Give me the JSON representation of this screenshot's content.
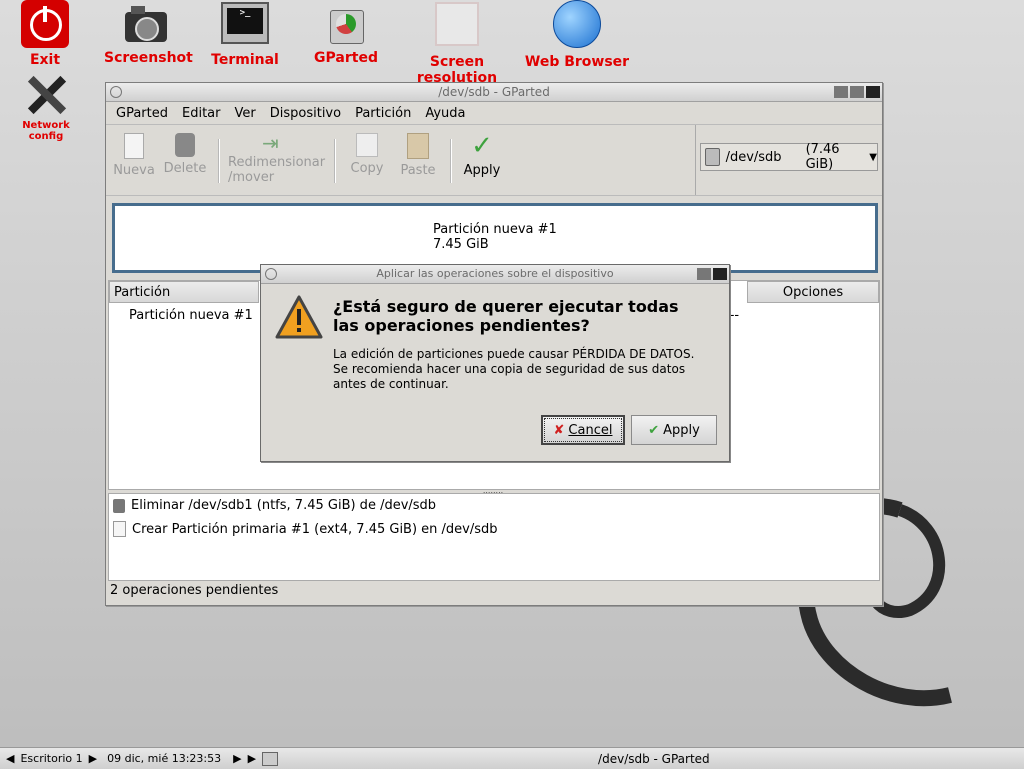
{
  "desktop": {
    "icons": [
      {
        "label": "Exit"
      },
      {
        "label": "Screenshot"
      },
      {
        "label": "Terminal"
      },
      {
        "label": "GParted"
      },
      {
        "label": "Screen resolution"
      },
      {
        "label": "Web Browser"
      },
      {
        "label": "Network config"
      }
    ]
  },
  "window": {
    "title": "/dev/sdb - GParted",
    "menu": [
      "GParted",
      "Editar",
      "Ver",
      "Dispositivo",
      "Partición",
      "Ayuda"
    ],
    "toolbar": {
      "nueva": "Nueva",
      "delete": "Delete",
      "resize_line1": "Redimensionar",
      "resize_line2": "/mover",
      "copy": "Copy",
      "paste": "Paste",
      "apply": "Apply"
    },
    "device": {
      "name": "/dev/sdb",
      "size": "(7.46 GiB)"
    },
    "diskmap": {
      "partition": "Partición nueva #1",
      "size": "7.45 GiB"
    },
    "table": {
      "headers": [
        "Partición",
        "Opciones"
      ],
      "rows": [
        {
          "partition": "Partición nueva #1",
          "extra": "---"
        }
      ]
    },
    "operations": [
      "Eliminar /dev/sdb1 (ntfs, 7.45 GiB) de /dev/sdb",
      "Crear Partición primaria #1 (ext4, 7.45 GiB) en /dev/sdb"
    ],
    "status": "2 operaciones pendientes"
  },
  "dialog": {
    "title": "Aplicar las operaciones sobre el dispositivo",
    "heading_line1": "¿Está seguro de querer ejecutar todas",
    "heading_line2": "las operaciones pendientes?",
    "body_line1": "La edición de particiones puede causar PÉRDIDA DE DATOS.",
    "body_line2": "Se recomienda hacer una copia de seguridad de sus datos",
    "body_line3": "antes de continuar.",
    "cancel": "Cancel",
    "apply": "Apply"
  },
  "taskbar": {
    "desktop": "Escritorio 1",
    "clock": "09 dic, mié 13:23:53",
    "task": "/dev/sdb - GParted"
  },
  "colors": {
    "desktop_label": "#e00000",
    "diskmap_border": "#476d8d"
  }
}
